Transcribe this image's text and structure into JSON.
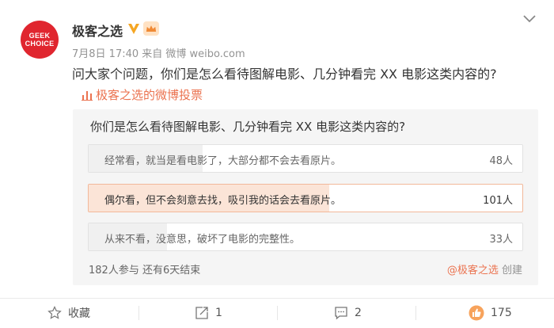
{
  "post": {
    "author": "极客之选",
    "avatar_text_1": "GEEK",
    "avatar_text_2": "CHOICE",
    "meta": "7月8日 17:40 来自 微博 weibo.com",
    "text": "问大家个问题，你们是怎么看待图解电影、几分钟看完 XX 电影这类内容的?",
    "vote_link": "极客之选的微博投票"
  },
  "poll": {
    "question": "你们是怎么看待图解电影、几分钟看完 XX 电影这类内容的?",
    "options": [
      {
        "label": "经常看，就当是看电影了，大部分都不会去看原片。",
        "count": "48人",
        "share": 0.263,
        "selected": false
      },
      {
        "label": "偶尔看，但不会刻意去找，吸引我的话会去看原片。",
        "count": "101人",
        "share": 0.555,
        "selected": true
      },
      {
        "label": "从来不看，没意思，破坏了电影的完整性。",
        "count": "33人",
        "share": 0.181,
        "selected": false
      }
    ],
    "footer_left": "182人参与  还有6天结束",
    "creator": "@极客之选",
    "creator_suffix": " 创建"
  },
  "actions": {
    "favorite": "收藏",
    "repost": "1",
    "comment": "2",
    "like": "175"
  },
  "colors": {
    "accent": "#eb7350",
    "brand_red": "#e0262f",
    "selected_fill": "#fbe4d7"
  },
  "icons": [
    "v-badge-icon",
    "crown-icon",
    "chevron-down-icon",
    "poll-icon",
    "star-icon",
    "repost-icon",
    "comment-icon",
    "like-icon"
  ]
}
